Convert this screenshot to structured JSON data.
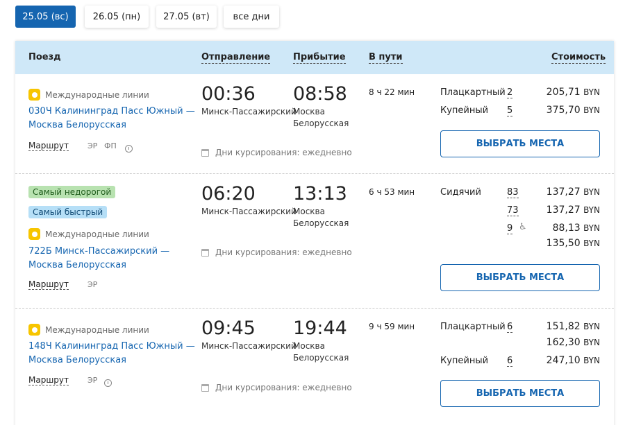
{
  "date_tabs": [
    {
      "label": "25.05 (вс)",
      "active": true
    },
    {
      "label": "26.05 (пн)",
      "active": false
    },
    {
      "label": "27.05 (вт)",
      "active": false
    },
    {
      "label": "все дни",
      "active": false
    }
  ],
  "table_header": {
    "train": "Поезд",
    "departure": "Отправление",
    "arrival": "Прибытие",
    "duration": "В пути",
    "cost": "Стоимость"
  },
  "trains": [
    {
      "badges": [],
      "carrier": "Международные линии",
      "name_line1": "030Ч Калининград Пасс Южный —",
      "name_line2": "Москва Белорусская",
      "route_label": "Маршрут",
      "codes": [
        "ЭР",
        "ФП"
      ],
      "dep_time": "00:36",
      "dep_station": "Минск-Пассажирский",
      "arr_time": "08:58",
      "arr_station_line1": "Москва",
      "arr_station_line2": "Белорусская",
      "duration": "8 ч 22 мин",
      "days": "Дни курсирования: ежедневно",
      "fares": [
        {
          "class": "Плацкартный",
          "seats": "2",
          "price": "205,71",
          "currency": "BYN"
        },
        {
          "class": "Купейный",
          "seats": "5",
          "price": "375,70",
          "currency": "BYN"
        }
      ],
      "button": "ВЫБРАТЬ МЕСТА"
    },
    {
      "badges": [
        {
          "text": "Самый недорогой",
          "color": "green"
        },
        {
          "text": "Самый быстрый",
          "color": "blue"
        }
      ],
      "carrier": "Международные линии",
      "name_line1": "722Б Минск-Пассажирский —",
      "name_line2": "Москва Белорусская",
      "route_label": "Маршрут",
      "codes": [
        "ЭР"
      ],
      "dep_time": "06:20",
      "dep_station": "Минск-Пассажирский",
      "arr_time": "13:13",
      "arr_station_line1": "Москва",
      "arr_station_line2": "Белорусская",
      "duration": "6 ч 53 мин",
      "days": "Дни курсирования: ежедневно",
      "fares": [
        {
          "class": "Сидячий",
          "seats": "83",
          "price": "137,27",
          "currency": "BYN"
        },
        {
          "class": "",
          "seats": "73",
          "price": "137,27",
          "currency": "BYN"
        },
        {
          "class": "",
          "seats": "9",
          "price": "88,13",
          "currency": "BYN",
          "wheelchair": true
        },
        {
          "class": "",
          "seats": "",
          "price": "135,50",
          "currency": "BYN"
        }
      ],
      "button": "ВЫБРАТЬ МЕСТА"
    },
    {
      "badges": [],
      "carrier": "Международные линии",
      "name_line1": "148Ч Калининград Пасс Южный —",
      "name_line2": "Москва Белорусская",
      "route_label": "Маршрут",
      "codes": [
        "ЭР"
      ],
      "dep_time": "09:45",
      "dep_station": "Минск-Пассажирский",
      "arr_time": "19:44",
      "arr_station_line1": "Москва",
      "arr_station_line2": "Белорусская",
      "duration": "9 ч 59 мин",
      "days": "Дни курсирования: ежедневно",
      "fares": [
        {
          "class": "Плацкартный",
          "seats": "6",
          "price": "151,82",
          "currency": "BYN"
        },
        {
          "class": "",
          "seats": "",
          "price": "162,30",
          "currency": "BYN"
        },
        {
          "class": "Купейный",
          "seats": "6",
          "price": "247,10",
          "currency": "BYN"
        }
      ],
      "button": "ВЫБРАТЬ МЕСТА"
    }
  ],
  "colors": {
    "accent": "#1565b0",
    "header_bg": "#cfe8f8",
    "badge_green": "#b8e2b0",
    "badge_blue": "#b6dff7",
    "carrier_icon": "#f7c500"
  },
  "icons": {
    "carrier": "yellow-logo-icon",
    "clock": "clock-icon",
    "calendar": "calendar-icon",
    "wheelchair": "wheelchair-icon"
  }
}
